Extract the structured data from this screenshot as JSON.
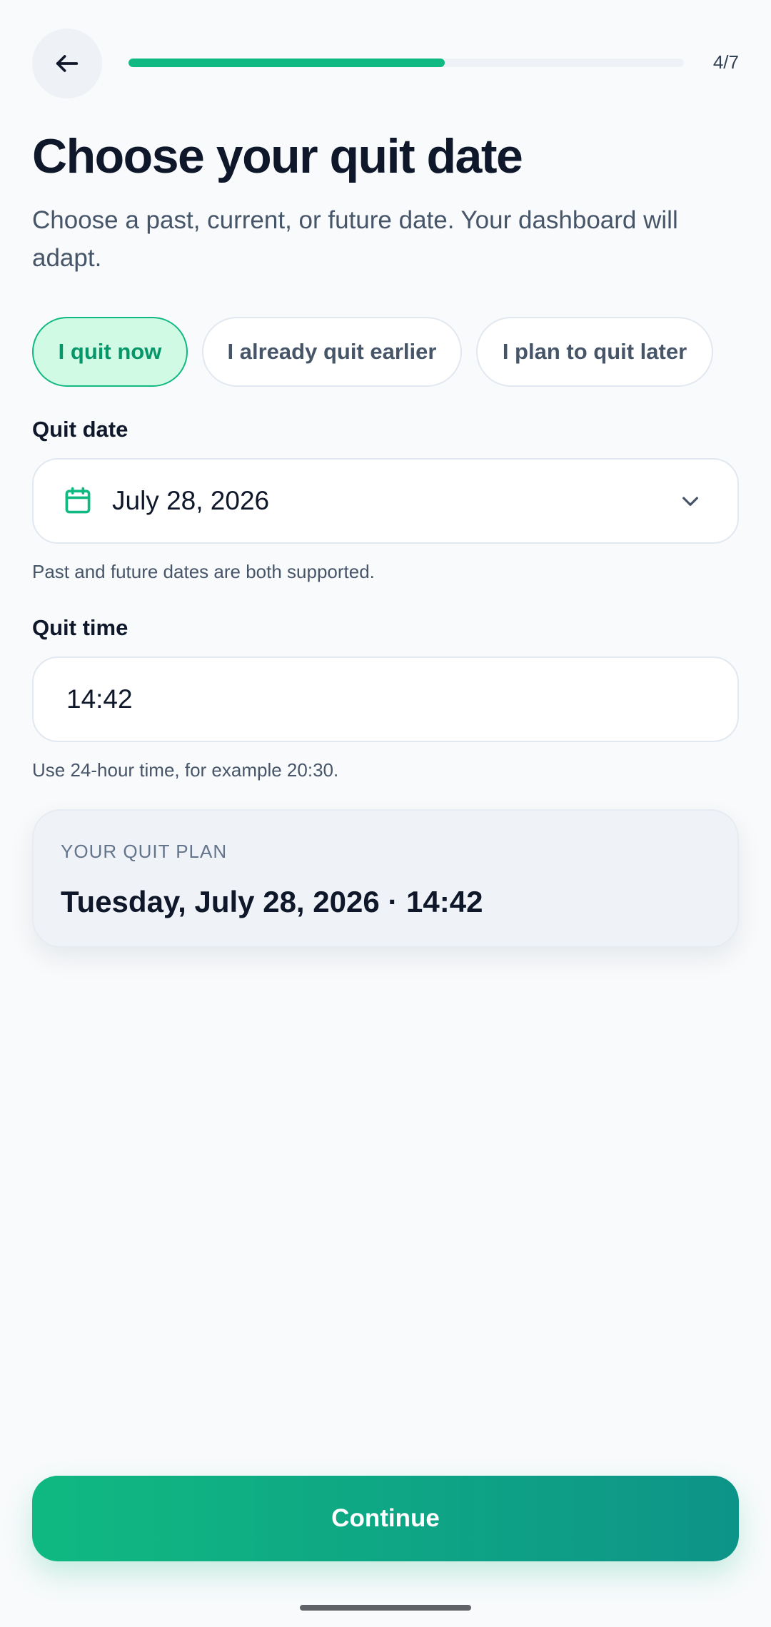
{
  "header": {
    "back_icon": "arrow-left-icon",
    "step_text": "4/7",
    "progress_fraction": 0.57,
    "accent_color": "#10b981"
  },
  "title": "Choose your quit date",
  "subtitle": "Choose a past, current, or future date. Your dashboard will adapt.",
  "choices": [
    {
      "label": "I quit now",
      "selected": true
    },
    {
      "label": "I already quit earlier",
      "selected": false
    },
    {
      "label": "I plan to quit later",
      "selected": false
    }
  ],
  "date": {
    "label": "Quit date",
    "icon": "calendar-icon",
    "value": "July 28, 2026",
    "dropdown_icon": "chevron-down-icon",
    "help": "Past and future dates are both supported."
  },
  "time": {
    "label": "Quit time",
    "value": "14:42",
    "help": "Use 24-hour time, for example 20:30."
  },
  "summary": {
    "kicker": "YOUR QUIT PLAN",
    "value": "Tuesday, July 28, 2026 · 14:42"
  },
  "continue_label": "Continue"
}
